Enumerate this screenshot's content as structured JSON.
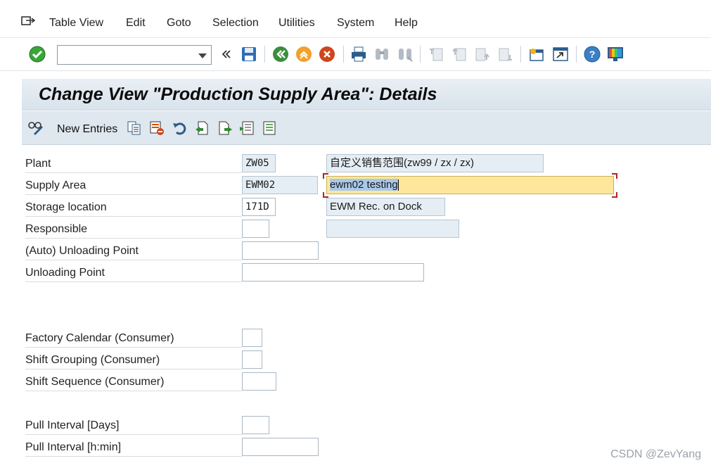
{
  "menu": {
    "items": [
      "Table View",
      "Edit",
      "Goto",
      "Selection",
      "Utilities",
      "System",
      "Help"
    ]
  },
  "toolbar": {
    "command_value": "",
    "icons": [
      "enter-icon",
      "command-field",
      "back-nav-icon",
      "save-icon",
      "back-icon",
      "exit-icon",
      "cancel-icon",
      "print-icon",
      "find-icon",
      "find-next-icon",
      "first-page-icon",
      "previous-page-icon",
      "next-page-icon",
      "last-page-icon",
      "create-session-icon",
      "shortcut-icon",
      "help-icon",
      "customize-layout-icon"
    ]
  },
  "title": "Change View \"Production Supply Area\": Details",
  "app_toolbar": {
    "new_entries_label": "New Entries"
  },
  "form": {
    "plant_label": "Plant",
    "plant_value": "ZW05",
    "plant_desc": "自定义销售范围(zw99 / zx / zx)",
    "supply_area_label": "Supply Area",
    "supply_area_value": "EWM02",
    "supply_area_desc": "ewm02 testing",
    "storage_location_label": "Storage location",
    "storage_location_value": "171D",
    "storage_location_desc": "EWM Rec. on Dock",
    "responsible_label": "Responsible",
    "responsible_value": "",
    "responsible_desc": "",
    "auto_unloading_label": "(Auto) Unloading Point",
    "auto_unloading_value": "",
    "unloading_point_label": "Unloading Point",
    "unloading_point_value": "",
    "factory_calendar_label": "Factory Calendar (Consumer)",
    "factory_calendar_value": "",
    "shift_grouping_label": "Shift Grouping (Consumer)",
    "shift_grouping_value": "",
    "shift_sequence_label": "Shift Sequence (Consumer)",
    "shift_sequence_value": "",
    "pull_interval_days_label": "Pull Interval [Days]",
    "pull_interval_days_value": "",
    "pull_interval_hmin_label": "Pull Interval [h:min]",
    "pull_interval_hmin_value": ""
  },
  "watermark": "CSDN @ZevYang",
  "colors": {
    "title_band": "#dde6ee",
    "focus_field": "#fce79a",
    "readonly_field": "#e6eef5",
    "selection": "#a9c8ea"
  }
}
